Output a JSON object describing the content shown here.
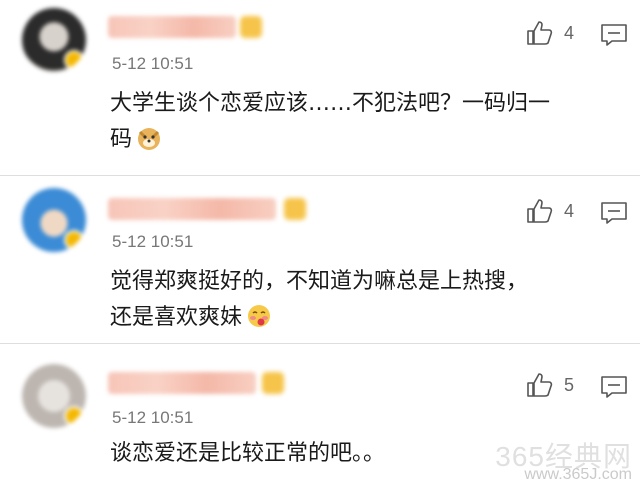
{
  "comments": [
    {
      "time": "5-12 10:51",
      "text_line1": "大学生谈个恋爱应该……不犯法吧？一码归一",
      "text_line2": "码",
      "likes": "4",
      "emoji_icon": "doge-emoji"
    },
    {
      "time": "5-12 10:51",
      "text_line1": "觉得郑爽挺好的，不知道为嘛总是上热搜，",
      "text_line2": "还是喜欢爽妹",
      "likes": "4",
      "emoji_icon": "blush-emoji"
    },
    {
      "time": "5-12 10:51",
      "text_line1": "谈恋爱还是比较正常的吧。。",
      "likes": "5"
    }
  ],
  "watermark": {
    "line1": "365经典网",
    "line2": "www.365J.com"
  },
  "colors": {
    "time": "#777777",
    "badge": "#f5b800",
    "divider": "#dedede"
  }
}
